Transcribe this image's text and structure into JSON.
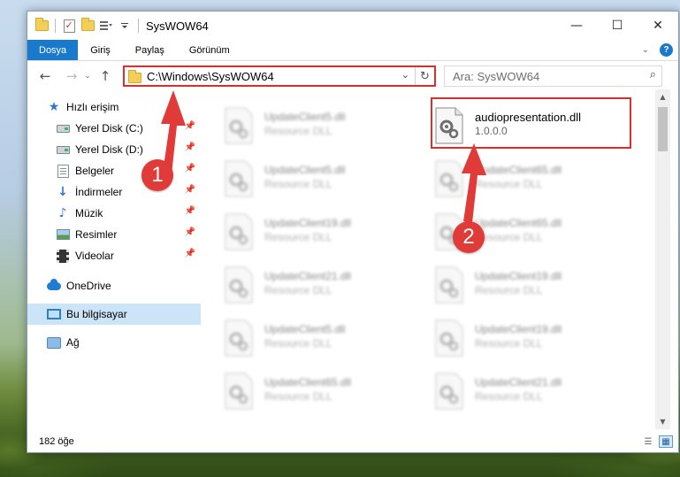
{
  "window": {
    "title": "SysWOW64",
    "controls": {
      "minimize": "—",
      "maximize": "☐",
      "close": "✕"
    }
  },
  "ribbon": {
    "tabs": [
      {
        "label": "Dosya",
        "active": true
      },
      {
        "label": "Giriş"
      },
      {
        "label": "Paylaş"
      },
      {
        "label": "Görünüm"
      }
    ],
    "help": "?"
  },
  "addressbar": {
    "path": "C:\\Windows\\SysWOW64",
    "search_placeholder": "Ara: SysWOW64"
  },
  "sidebar": {
    "quick_access": "Hızlı erişim",
    "items": [
      {
        "label": "Yerel Disk (C:)",
        "icon": "drive-icon",
        "pinned": true
      },
      {
        "label": "Yerel Disk (D:)",
        "icon": "drive-icon",
        "pinned": true
      },
      {
        "label": "Belgeler",
        "icon": "documents-icon",
        "pinned": true
      },
      {
        "label": "İndirmeler",
        "icon": "downloads-icon",
        "pinned": true
      },
      {
        "label": "Müzik",
        "icon": "music-icon",
        "pinned": true
      },
      {
        "label": "Resimler",
        "icon": "pictures-icon",
        "pinned": true
      },
      {
        "label": "Videolar",
        "icon": "videos-icon",
        "pinned": true
      }
    ],
    "onedrive": "OneDrive",
    "this_pc": "Bu bilgisayar",
    "network": "Ağ"
  },
  "files": {
    "left_column": [
      {
        "name": "UpdateClient5.dll",
        "desc": "Resource DLL"
      },
      {
        "name": "UpdateClient5.dll",
        "desc": "Resource DLL"
      },
      {
        "name": "UpdateClient19.dll",
        "desc": "Resource DLL"
      },
      {
        "name": "UpdateClient21.dll",
        "desc": "Resource DLL"
      },
      {
        "name": "UpdateClient5.dll",
        "desc": "Resource DLL"
      },
      {
        "name": "UpdateClient65.dll",
        "desc": "Resource DLL"
      }
    ],
    "right_column": [
      {
        "name": "audiopresentation.dll",
        "desc": "1.0.0.0",
        "highlight": true
      },
      {
        "name": "UpdateClient65.dll",
        "desc": "Resource DLL"
      },
      {
        "name": "UpdateClient65.dll",
        "desc": "Resource DLL"
      },
      {
        "name": "UpdateClient19.dll",
        "desc": "Resource DLL"
      },
      {
        "name": "UpdateClient19.dll",
        "desc": "Resource DLL"
      },
      {
        "name": "UpdateClient21.dll",
        "desc": "Resource DLL"
      }
    ]
  },
  "status": {
    "item_count": "182 öğe"
  },
  "annotations": {
    "step1": "1",
    "step2": "2",
    "color": "#e03b38"
  }
}
